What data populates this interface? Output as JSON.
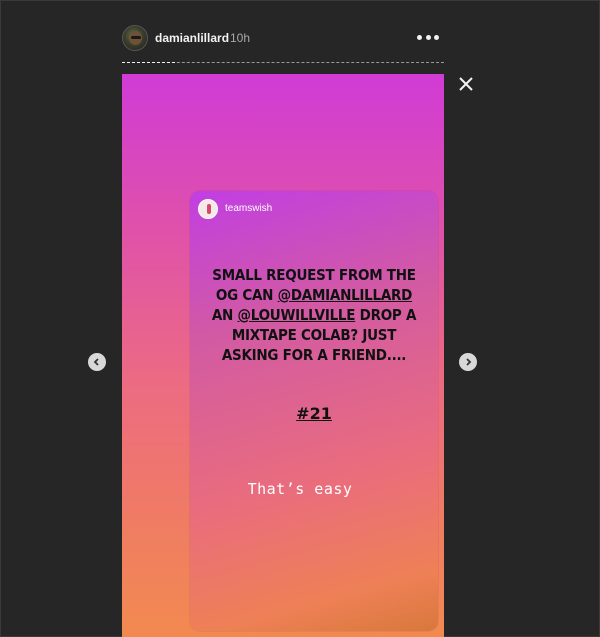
{
  "header": {
    "username": "damianlillard",
    "time": "10h"
  },
  "story": {
    "card": {
      "username": "teamswish",
      "text_parts": [
        "SMALL REQUEST FROM THE OG CAN ",
        "@DAMIANLILLARD",
        " AN ",
        "@LOUWILLVILLE",
        " DROP A MIXTAPE COLAB? JUST ASKING FOR A FRIEND...."
      ],
      "hashtag": "#21"
    },
    "reply": "That’s easy",
    "progress": 0.16
  },
  "icons": {
    "more": "more-options-icon",
    "close": "close-icon",
    "prev": "chevron-left-icon",
    "next": "chevron-right-icon"
  }
}
